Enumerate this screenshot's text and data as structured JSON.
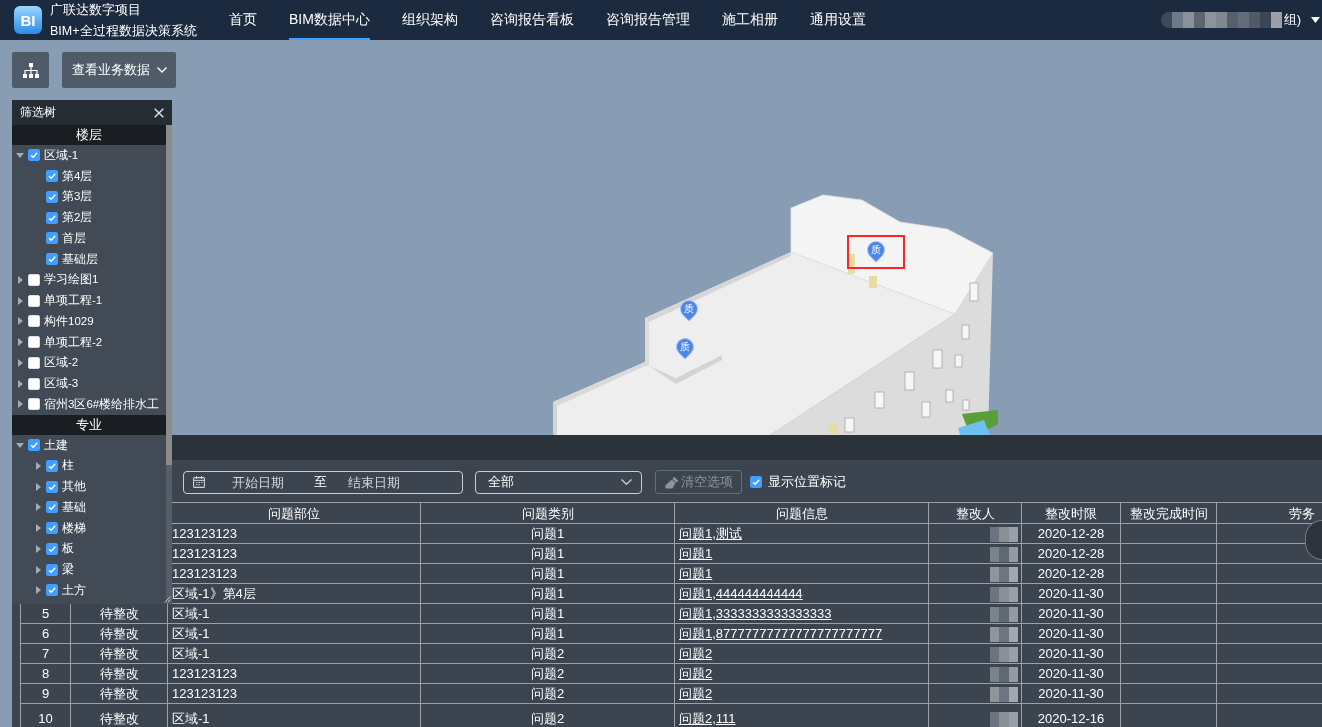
{
  "header": {
    "logo": "BI",
    "title": "广联达数字项目",
    "subtitle": "BIM+全过程数据决策系统",
    "nav": [
      {
        "label": "首页",
        "selected": false
      },
      {
        "label": "BIM数据中心",
        "selected": true
      },
      {
        "label": "组织架构",
        "selected": false
      },
      {
        "label": "咨询报告看板",
        "selected": false
      },
      {
        "label": "咨询报告管理",
        "selected": false
      },
      {
        "label": "施工相册",
        "selected": false
      },
      {
        "label": "通用设置",
        "selected": false
      }
    ],
    "user": {
      "blurred": true,
      "name": "组)"
    }
  },
  "toolbar": {
    "data_button": "查看业务数据"
  },
  "filter_tree": {
    "title": "筛选树",
    "sections": [
      {
        "title": "楼层",
        "items": [
          {
            "label": "区域-1",
            "checked": true,
            "expanded": true,
            "children": [
              {
                "label": "第4层",
                "checked": true
              },
              {
                "label": "第3层",
                "checked": true
              },
              {
                "label": "第2层",
                "checked": true
              },
              {
                "label": "首层",
                "checked": true
              },
              {
                "label": "基础层",
                "checked": true
              }
            ]
          },
          {
            "label": "学习绘图1",
            "checked": false,
            "expanded": false
          },
          {
            "label": "单项工程-1",
            "checked": false,
            "expanded": false
          },
          {
            "label": "构件1029",
            "checked": false,
            "expanded": false
          },
          {
            "label": "单项工程-2",
            "checked": false,
            "expanded": false
          },
          {
            "label": "区域-2",
            "checked": false,
            "expanded": false
          },
          {
            "label": "区域-3",
            "checked": false,
            "expanded": false
          },
          {
            "label": "宿州3区6#楼给排水工",
            "checked": false,
            "expanded": false
          }
        ]
      },
      {
        "title": "专业",
        "items": [
          {
            "label": "土建",
            "checked": true,
            "expanded": true,
            "children": [
              {
                "label": "柱",
                "checked": true,
                "expanded": false
              },
              {
                "label": "其他",
                "checked": true,
                "expanded": false
              },
              {
                "label": "基础",
                "checked": true,
                "expanded": false
              },
              {
                "label": "楼梯",
                "checked": true,
                "expanded": false
              },
              {
                "label": "板",
                "checked": true,
                "expanded": false
              },
              {
                "label": "梁",
                "checked": true,
                "expanded": false
              },
              {
                "label": "土方",
                "checked": true,
                "expanded": false
              }
            ]
          }
        ]
      }
    ]
  },
  "markers": [
    {
      "label": "质",
      "selected": false
    },
    {
      "label": "质",
      "selected": false
    },
    {
      "label": "质",
      "selected": true
    }
  ],
  "issue_panel": {
    "filters": {
      "start_date_placeholder": "开始日期",
      "range_separator": "至",
      "end_date_placeholder": "结束日期",
      "category_select": "全部",
      "clear_button": {
        "label": "清空选项",
        "disabled": true
      },
      "show_markers": {
        "label": "显示位置标记",
        "checked": true
      }
    },
    "table": {
      "columns": [
        "问题部位",
        "问题类别",
        "问题信息",
        "整改人",
        "整改时限",
        "整改完成时间",
        "劳务"
      ],
      "rows": [
        {
          "location": "123123123",
          "category": "问题1",
          "info": "问题1,测试",
          "assignee_blurred": true,
          "deadline": "2020-12-28"
        },
        {
          "location": "123123123",
          "category": "问题1",
          "info": "问题1",
          "assignee_blurred": true,
          "deadline": "2020-12-28"
        },
        {
          "location": "123123123",
          "category": "问题1",
          "info": "问题1",
          "assignee_blurred": true,
          "deadline": "2020-12-28"
        },
        {
          "location": "区域-1》第4层",
          "category": "问题1",
          "info": "问题1,444444444444",
          "assignee_blurred": true,
          "deadline": "2020-11-30"
        },
        {
          "number": "5",
          "result": "待整改",
          "location": "区域-1",
          "category": "问题1",
          "info": "问题1,3333333333333333",
          "assignee_blurred": true,
          "deadline": "2020-11-30"
        },
        {
          "number": "6",
          "result": "待整改",
          "location": "区域-1",
          "category": "问题1",
          "info": "问题1,87777777777777777777777",
          "assignee_blurred": true,
          "deadline": "2020-11-30"
        },
        {
          "number": "7",
          "result": "待整改",
          "location": "区域-1",
          "category": "问题2",
          "info": "问题2",
          "assignee_blurred": true,
          "deadline": "2020-11-30"
        },
        {
          "number": "8",
          "result": "待整改",
          "location": "123123123",
          "category": "问题2",
          "info": "问题2",
          "assignee_blurred": true,
          "deadline": "2020-11-30"
        },
        {
          "number": "9",
          "result": "待整改",
          "location": "123123123",
          "category": "问题2",
          "info": "问题2",
          "assignee_blurred": true,
          "deadline": "2020-11-30"
        },
        {
          "number": "10",
          "result": "待整改",
          "location": "区域-1",
          "category": "问题2",
          "info": "问题2,111",
          "assignee_blurred": true,
          "deadline": "2020-12-16"
        }
      ]
    }
  }
}
